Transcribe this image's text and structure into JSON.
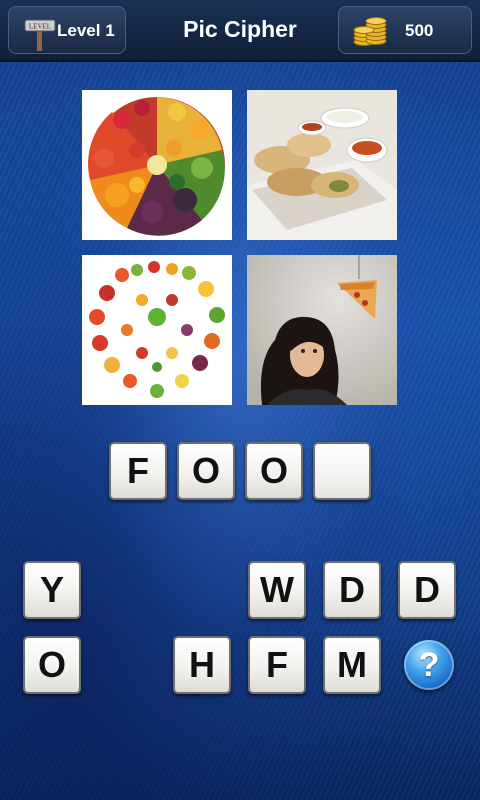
{
  "header": {
    "level_label": "Level 1",
    "sign_text": "LEVEL",
    "title": "Pic Cipher",
    "coins": "500"
  },
  "pictures": [
    {
      "name": "picture-fruit-circle"
    },
    {
      "name": "picture-pastries-with-dips"
    },
    {
      "name": "picture-vegetable-heart"
    },
    {
      "name": "picture-woman-pizza-slice"
    }
  ],
  "answer": {
    "letters": [
      "F",
      "O",
      "O",
      ""
    ]
  },
  "letter_bank": {
    "row1": [
      "Y",
      "",
      "",
      "W",
      "D",
      "D"
    ],
    "row2": [
      "O",
      "",
      "H",
      "F",
      "M"
    ]
  },
  "hint_button": {
    "symbol": "?"
  }
}
